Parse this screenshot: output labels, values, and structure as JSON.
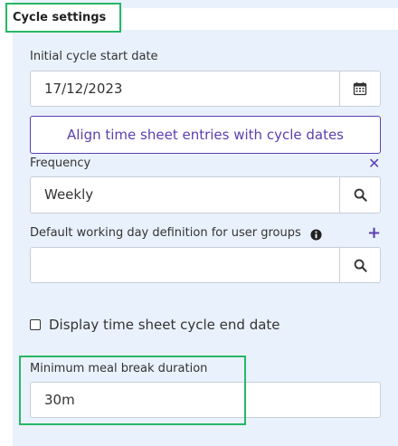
{
  "section": {
    "title": "Cycle settings"
  },
  "initial_cycle": {
    "label": "Initial cycle start date",
    "value": "17/12/2023",
    "icon": "calendar-icon"
  },
  "align_button": {
    "label": "Align time sheet entries with cycle dates"
  },
  "frequency": {
    "label": "Frequency",
    "value": "Weekly",
    "clear_icon": "close-icon",
    "search_icon": "search-icon"
  },
  "working_day": {
    "label": "Default working day definition for user groups",
    "value": "",
    "info_icon": "info-icon",
    "add_icon": "plus-icon",
    "search_icon": "search-icon"
  },
  "display_end_date": {
    "label": "Display time sheet cycle end date",
    "checked": false
  },
  "meal_break": {
    "label": "Minimum meal break duration",
    "value": "30m"
  },
  "colors": {
    "panel_bg": "#e9f1fc",
    "accent": "#5b3fb0",
    "highlight": "#27b765"
  }
}
